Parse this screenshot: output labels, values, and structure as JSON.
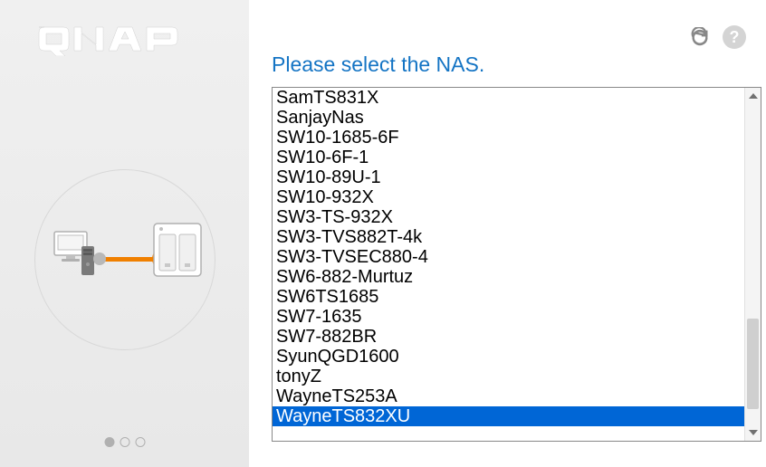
{
  "brand": "QNAP",
  "heading": "Please select the NAS.",
  "nas_list": [
    {
      "name": "SamTS831X",
      "selected": false
    },
    {
      "name": "SanjayNas",
      "selected": false
    },
    {
      "name": "SW10-1685-6F",
      "selected": false
    },
    {
      "name": "SW10-6F-1",
      "selected": false
    },
    {
      "name": "SW10-89U-1",
      "selected": false
    },
    {
      "name": "SW10-932X",
      "selected": false
    },
    {
      "name": "SW3-TS-932X",
      "selected": false
    },
    {
      "name": "SW3-TVS882T-4k",
      "selected": false
    },
    {
      "name": "SW3-TVSEC880-4",
      "selected": false
    },
    {
      "name": "SW6-882-Murtuz",
      "selected": false
    },
    {
      "name": "SW6TS1685",
      "selected": false
    },
    {
      "name": "SW7-1635",
      "selected": false
    },
    {
      "name": "SW7-882BR",
      "selected": false
    },
    {
      "name": "SyunQGD1600",
      "selected": false
    },
    {
      "name": "tonyZ",
      "selected": false
    },
    {
      "name": "WayneTS253A",
      "selected": false
    },
    {
      "name": "WayneTS832XU",
      "selected": true
    }
  ],
  "pagination": {
    "total": 3,
    "active": 0
  }
}
